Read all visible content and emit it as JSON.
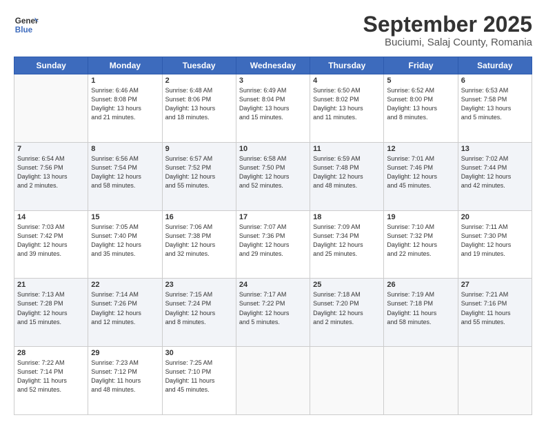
{
  "header": {
    "logo_line1": "General",
    "logo_line2": "Blue",
    "title": "September 2025",
    "subtitle": "Buciumi, Salaj County, Romania"
  },
  "days_of_week": [
    "Sunday",
    "Monday",
    "Tuesday",
    "Wednesday",
    "Thursday",
    "Friday",
    "Saturday"
  ],
  "weeks": [
    {
      "shaded": false,
      "days": [
        {
          "num": "",
          "info": ""
        },
        {
          "num": "1",
          "info": "Sunrise: 6:46 AM\nSunset: 8:08 PM\nDaylight: 13 hours\nand 21 minutes."
        },
        {
          "num": "2",
          "info": "Sunrise: 6:48 AM\nSunset: 8:06 PM\nDaylight: 13 hours\nand 18 minutes."
        },
        {
          "num": "3",
          "info": "Sunrise: 6:49 AM\nSunset: 8:04 PM\nDaylight: 13 hours\nand 15 minutes."
        },
        {
          "num": "4",
          "info": "Sunrise: 6:50 AM\nSunset: 8:02 PM\nDaylight: 13 hours\nand 11 minutes."
        },
        {
          "num": "5",
          "info": "Sunrise: 6:52 AM\nSunset: 8:00 PM\nDaylight: 13 hours\nand 8 minutes."
        },
        {
          "num": "6",
          "info": "Sunrise: 6:53 AM\nSunset: 7:58 PM\nDaylight: 13 hours\nand 5 minutes."
        }
      ]
    },
    {
      "shaded": true,
      "days": [
        {
          "num": "7",
          "info": "Sunrise: 6:54 AM\nSunset: 7:56 PM\nDaylight: 13 hours\nand 2 minutes."
        },
        {
          "num": "8",
          "info": "Sunrise: 6:56 AM\nSunset: 7:54 PM\nDaylight: 12 hours\nand 58 minutes."
        },
        {
          "num": "9",
          "info": "Sunrise: 6:57 AM\nSunset: 7:52 PM\nDaylight: 12 hours\nand 55 minutes."
        },
        {
          "num": "10",
          "info": "Sunrise: 6:58 AM\nSunset: 7:50 PM\nDaylight: 12 hours\nand 52 minutes."
        },
        {
          "num": "11",
          "info": "Sunrise: 6:59 AM\nSunset: 7:48 PM\nDaylight: 12 hours\nand 48 minutes."
        },
        {
          "num": "12",
          "info": "Sunrise: 7:01 AM\nSunset: 7:46 PM\nDaylight: 12 hours\nand 45 minutes."
        },
        {
          "num": "13",
          "info": "Sunrise: 7:02 AM\nSunset: 7:44 PM\nDaylight: 12 hours\nand 42 minutes."
        }
      ]
    },
    {
      "shaded": false,
      "days": [
        {
          "num": "14",
          "info": "Sunrise: 7:03 AM\nSunset: 7:42 PM\nDaylight: 12 hours\nand 39 minutes."
        },
        {
          "num": "15",
          "info": "Sunrise: 7:05 AM\nSunset: 7:40 PM\nDaylight: 12 hours\nand 35 minutes."
        },
        {
          "num": "16",
          "info": "Sunrise: 7:06 AM\nSunset: 7:38 PM\nDaylight: 12 hours\nand 32 minutes."
        },
        {
          "num": "17",
          "info": "Sunrise: 7:07 AM\nSunset: 7:36 PM\nDaylight: 12 hours\nand 29 minutes."
        },
        {
          "num": "18",
          "info": "Sunrise: 7:09 AM\nSunset: 7:34 PM\nDaylight: 12 hours\nand 25 minutes."
        },
        {
          "num": "19",
          "info": "Sunrise: 7:10 AM\nSunset: 7:32 PM\nDaylight: 12 hours\nand 22 minutes."
        },
        {
          "num": "20",
          "info": "Sunrise: 7:11 AM\nSunset: 7:30 PM\nDaylight: 12 hours\nand 19 minutes."
        }
      ]
    },
    {
      "shaded": true,
      "days": [
        {
          "num": "21",
          "info": "Sunrise: 7:13 AM\nSunset: 7:28 PM\nDaylight: 12 hours\nand 15 minutes."
        },
        {
          "num": "22",
          "info": "Sunrise: 7:14 AM\nSunset: 7:26 PM\nDaylight: 12 hours\nand 12 minutes."
        },
        {
          "num": "23",
          "info": "Sunrise: 7:15 AM\nSunset: 7:24 PM\nDaylight: 12 hours\nand 8 minutes."
        },
        {
          "num": "24",
          "info": "Sunrise: 7:17 AM\nSunset: 7:22 PM\nDaylight: 12 hours\nand 5 minutes."
        },
        {
          "num": "25",
          "info": "Sunrise: 7:18 AM\nSunset: 7:20 PM\nDaylight: 12 hours\nand 2 minutes."
        },
        {
          "num": "26",
          "info": "Sunrise: 7:19 AM\nSunset: 7:18 PM\nDaylight: 11 hours\nand 58 minutes."
        },
        {
          "num": "27",
          "info": "Sunrise: 7:21 AM\nSunset: 7:16 PM\nDaylight: 11 hours\nand 55 minutes."
        }
      ]
    },
    {
      "shaded": false,
      "days": [
        {
          "num": "28",
          "info": "Sunrise: 7:22 AM\nSunset: 7:14 PM\nDaylight: 11 hours\nand 52 minutes."
        },
        {
          "num": "29",
          "info": "Sunrise: 7:23 AM\nSunset: 7:12 PM\nDaylight: 11 hours\nand 48 minutes."
        },
        {
          "num": "30",
          "info": "Sunrise: 7:25 AM\nSunset: 7:10 PM\nDaylight: 11 hours\nand 45 minutes."
        },
        {
          "num": "",
          "info": ""
        },
        {
          "num": "",
          "info": ""
        },
        {
          "num": "",
          "info": ""
        },
        {
          "num": "",
          "info": ""
        }
      ]
    }
  ]
}
